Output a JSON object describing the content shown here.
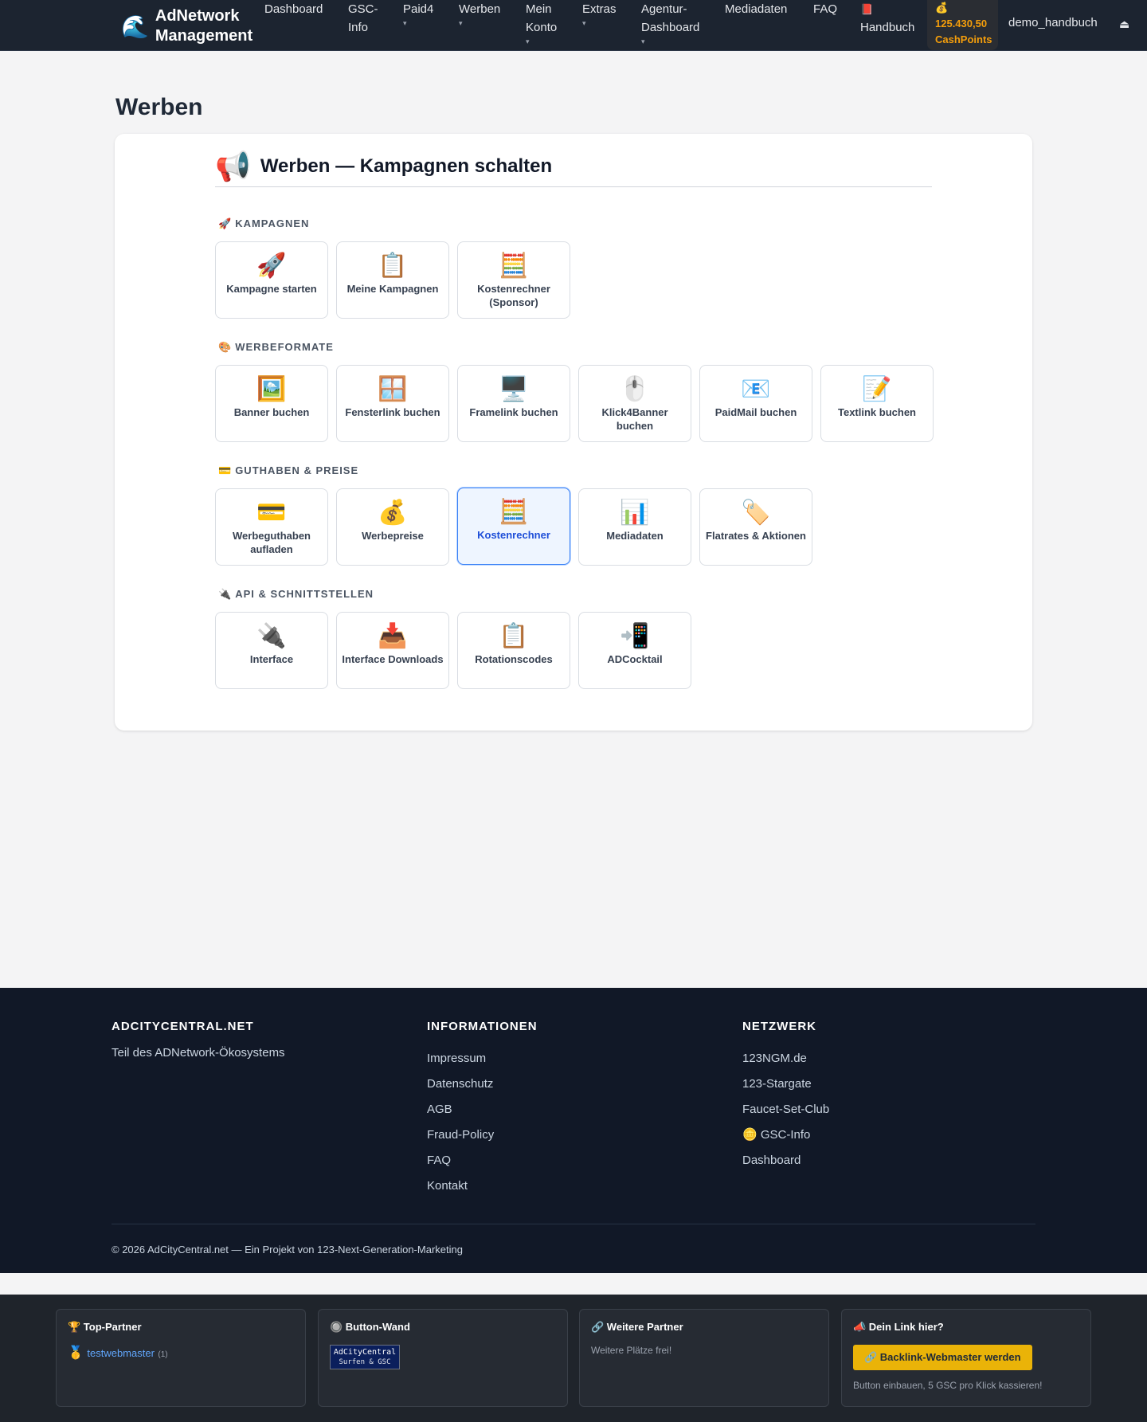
{
  "brand": {
    "icon": "🌊",
    "name": "AdNetwork Management"
  },
  "nav": {
    "items": [
      {
        "label": "Dashboard",
        "caret": ""
      },
      {
        "label": "GSC-Info",
        "caret": ""
      },
      {
        "label": "Paid4",
        "caret": "▾"
      },
      {
        "label": "Werben",
        "caret": "▾"
      },
      {
        "label": "Mein Konto",
        "caret": "▾"
      },
      {
        "label": "Extras",
        "caret": "▾"
      },
      {
        "label": "Agentur-Dashboard",
        "caret": "▾"
      },
      {
        "label": "Mediadaten",
        "caret": ""
      },
      {
        "label": "FAQ",
        "caret": ""
      },
      {
        "label": "Handbuch",
        "icon": "📕"
      }
    ],
    "cash_icon": "💰",
    "cash_amount": "125.430,50",
    "cash_unit": "CashPoints",
    "username": "demo_handbuch",
    "logout_icon": "⏏"
  },
  "page": {
    "title": "Werben"
  },
  "card": {
    "icon": "📢",
    "title": "Werben — Kampagnen schalten",
    "sections": [
      {
        "icon": "🚀",
        "label": "KAMPAGNEN",
        "tiles": [
          {
            "icon": "🚀",
            "label": "Kampagne starten"
          },
          {
            "icon": "📋",
            "label": "Meine Kampagnen"
          },
          {
            "icon": "🧮",
            "label": "Kostenrechner (Sponsor)"
          }
        ]
      },
      {
        "icon": "🎨",
        "label": "WERBEFORMATE",
        "tiles": [
          {
            "icon": "🖼️",
            "label": "Banner buchen"
          },
          {
            "icon": "🪟",
            "label": "Fensterlink buchen"
          },
          {
            "icon": "🖥️",
            "label": "Framelink buchen"
          },
          {
            "icon": "🖱️",
            "label": "Klick4Banner buchen"
          },
          {
            "icon": "📧",
            "label": "PaidMail buchen"
          },
          {
            "icon": "📝",
            "label": "Textlink buchen"
          }
        ]
      },
      {
        "icon": "💳",
        "label": "GUTHABEN & PREISE",
        "tiles": [
          {
            "icon": "💳",
            "label": "Werbeguthaben aufladen"
          },
          {
            "icon": "💰",
            "label": "Werbepreise"
          },
          {
            "icon": "🧮",
            "label": "Kostenrechner"
          },
          {
            "icon": "📊",
            "label": "Mediadaten"
          },
          {
            "icon": "🏷️",
            "label": "Flatrates & Aktionen"
          }
        ]
      },
      {
        "icon": "🔌",
        "label": "API & SCHNITTSTELLEN",
        "tiles": [
          {
            "icon": "🔌",
            "label": "Interface"
          },
          {
            "icon": "📥",
            "label": "Interface Downloads"
          },
          {
            "icon": "📋",
            "label": "Rotationscodes"
          },
          {
            "icon": "📲",
            "label": "ADCocktail"
          }
        ]
      }
    ]
  },
  "footer": {
    "col1": {
      "title": "ADCITYCENTRAL.NET",
      "text": "Teil des ADNetwork-Ökosystems"
    },
    "col2": {
      "title": "INFORMATIONEN",
      "links": [
        "Impressum",
        "Datenschutz",
        "AGB",
        "Fraud-Policy",
        "FAQ",
        "Kontakt"
      ]
    },
    "col3": {
      "title": "NETZWERK",
      "links": [
        "123NGM.de",
        "123-Stargate",
        "Faucet-Set-Club",
        "🪙 GSC-Info",
        "Dashboard"
      ]
    },
    "copyright": "© 2026 AdCityCentral.net — Ein Projekt von 123-Next-Generation-Marketing"
  },
  "partners": {
    "top": {
      "title": "🏆 Top-Partner",
      "medal": "🥇",
      "link": "testwebmaster",
      "count": "(1)"
    },
    "wall": {
      "title": "🔘 Button-Wand",
      "button_line1": "AdCityCentral",
      "button_line2": "Surfen & GSC"
    },
    "more": {
      "title": "🔗 Weitere Partner",
      "text": "Weitere Plätze frei!"
    },
    "yours": {
      "title": "📣 Dein Link hier?",
      "cta": "🔗 Backlink-Webmaster werden",
      "text": "Button einbauen, 5 GSC pro Klick kassieren!"
    }
  }
}
